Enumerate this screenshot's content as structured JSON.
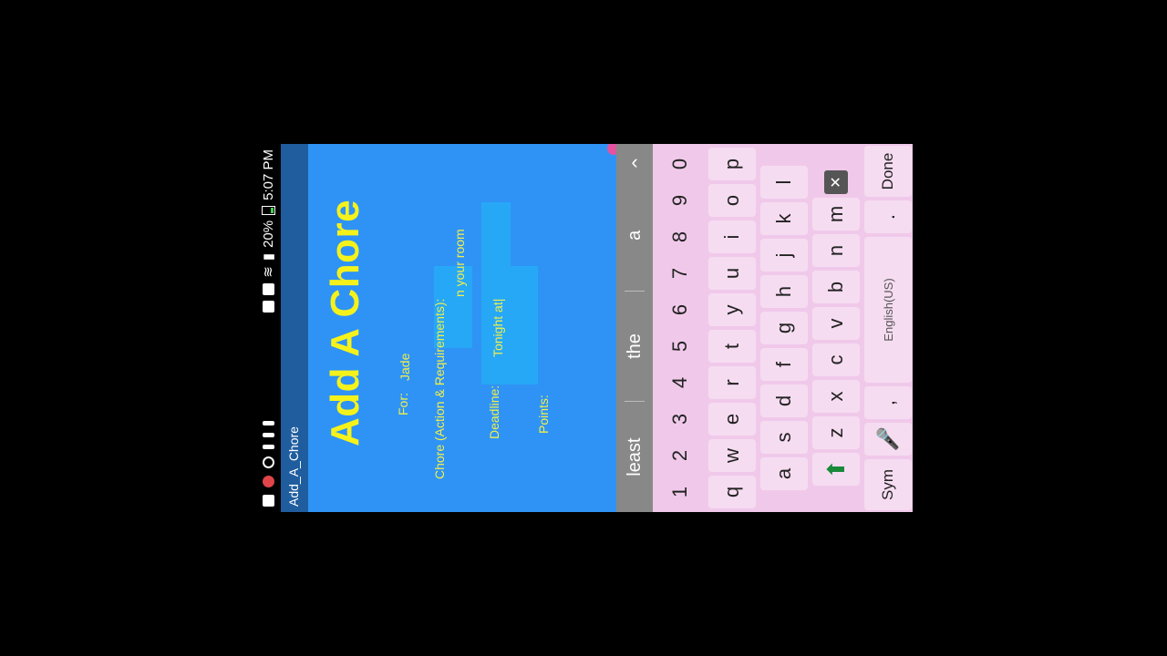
{
  "status_bar": {
    "time": "5:07 PM",
    "battery": "20%"
  },
  "app": {
    "name": "Add_A_Chore"
  },
  "form": {
    "title": "Add A Chore",
    "for_label": "For:",
    "for_value": "Jade",
    "chore_label": "Chore (Action & Requirements):",
    "chore_value": "n your room",
    "deadline_label": "Deadline:",
    "deadline_value": "Tonight at|",
    "points_label": "Points:"
  },
  "suggestions": [
    "least",
    "the",
    "a"
  ],
  "keyboard": {
    "number_row": [
      "1",
      "2",
      "3",
      "4",
      "5",
      "6",
      "7",
      "8",
      "9",
      "0"
    ],
    "row1": [
      "q",
      "w",
      "e",
      "r",
      "t",
      "y",
      "u",
      "i",
      "o",
      "p"
    ],
    "row2": [
      "a",
      "s",
      "d",
      "f",
      "g",
      "h",
      "j",
      "k",
      "l"
    ],
    "row3": [
      "z",
      "x",
      "c",
      "v",
      "b",
      "n",
      "m"
    ],
    "sym_label": "Sym",
    "comma": ",",
    "space_label": "English(US)",
    "period": ".",
    "done_label": "Done"
  },
  "colors": {
    "background": "#2f93f5",
    "title": "#f5f21b",
    "keyboard": "#f0c9ea"
  }
}
